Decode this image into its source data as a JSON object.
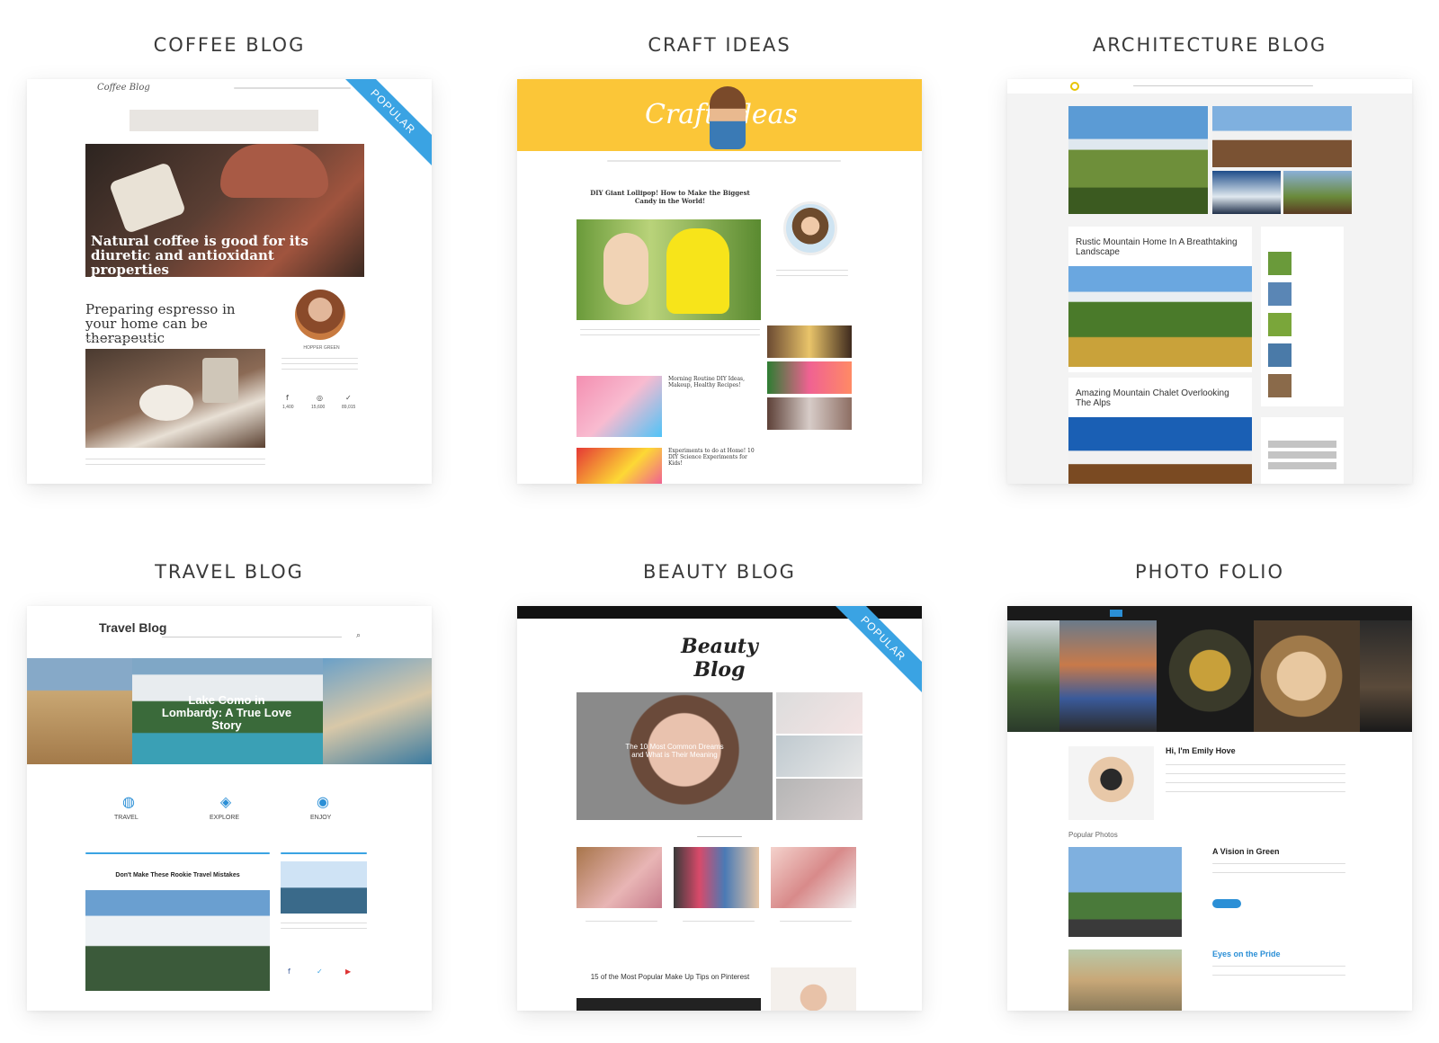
{
  "grid": {
    "coffee": {
      "title": "COFFEE BLOG",
      "ribbon": "POPULAR",
      "logo": "Coffee Blog",
      "hero_caption": "Natural coffee is good for its diuretic and antioxidant properties",
      "post_title": "Preparing espresso in your home can be therapeutic",
      "author_name": "HOPPER GREEN",
      "stats": [
        "1,400",
        "15,600",
        "89,015"
      ]
    },
    "craft": {
      "title": "CRAFT IDEAS",
      "header_script": "Craft Ideas",
      "post1": "DIY Giant Lollipop! How to Make the Biggest Candy in the World!",
      "post2": "Morning Routine DIY Ideas, Makeup, Healthy Recipes!",
      "post3": "Experiments to do at Home! 10 DIY Science Experiments for Kids!"
    },
    "architecture": {
      "title": "ARCHITECTURE BLOG",
      "post1": "Rustic Mountain Home In A Breathtaking Landscape",
      "post2": "Amazing Mountain Chalet Overlooking The Alps"
    },
    "travel": {
      "title": "TRAVEL BLOG",
      "logo": "Travel Blog",
      "hero_title": "Lake Como in Lombardy: A True Love Story",
      "features": [
        "TRAVEL",
        "EXPLORE",
        "ENJOY"
      ],
      "post_title": "Don't Make These Rookie Travel Mistakes"
    },
    "beauty": {
      "title": "BEAUTY BLOG",
      "ribbon": "POPULAR",
      "logo": "Beauty Blog",
      "hero_title": "The 10 Most Common Dreams and What is Their Meaning",
      "bottom_post": "15 of the Most Popular Make Up Tips on Pinterest"
    },
    "photo": {
      "title": "PHOTO FOLIO",
      "greeting": "Hi, I'm Emily Hove",
      "section": "Popular Photos",
      "post1": "A Vision in Green",
      "post2": "Eyes on the Pride"
    }
  },
  "colors": {
    "accent_blue": "#3aa3e3",
    "craft_yellow": "#fbc638",
    "photo_dark": "#1a1a1a",
    "travel_blue": "#2b8fd6"
  }
}
